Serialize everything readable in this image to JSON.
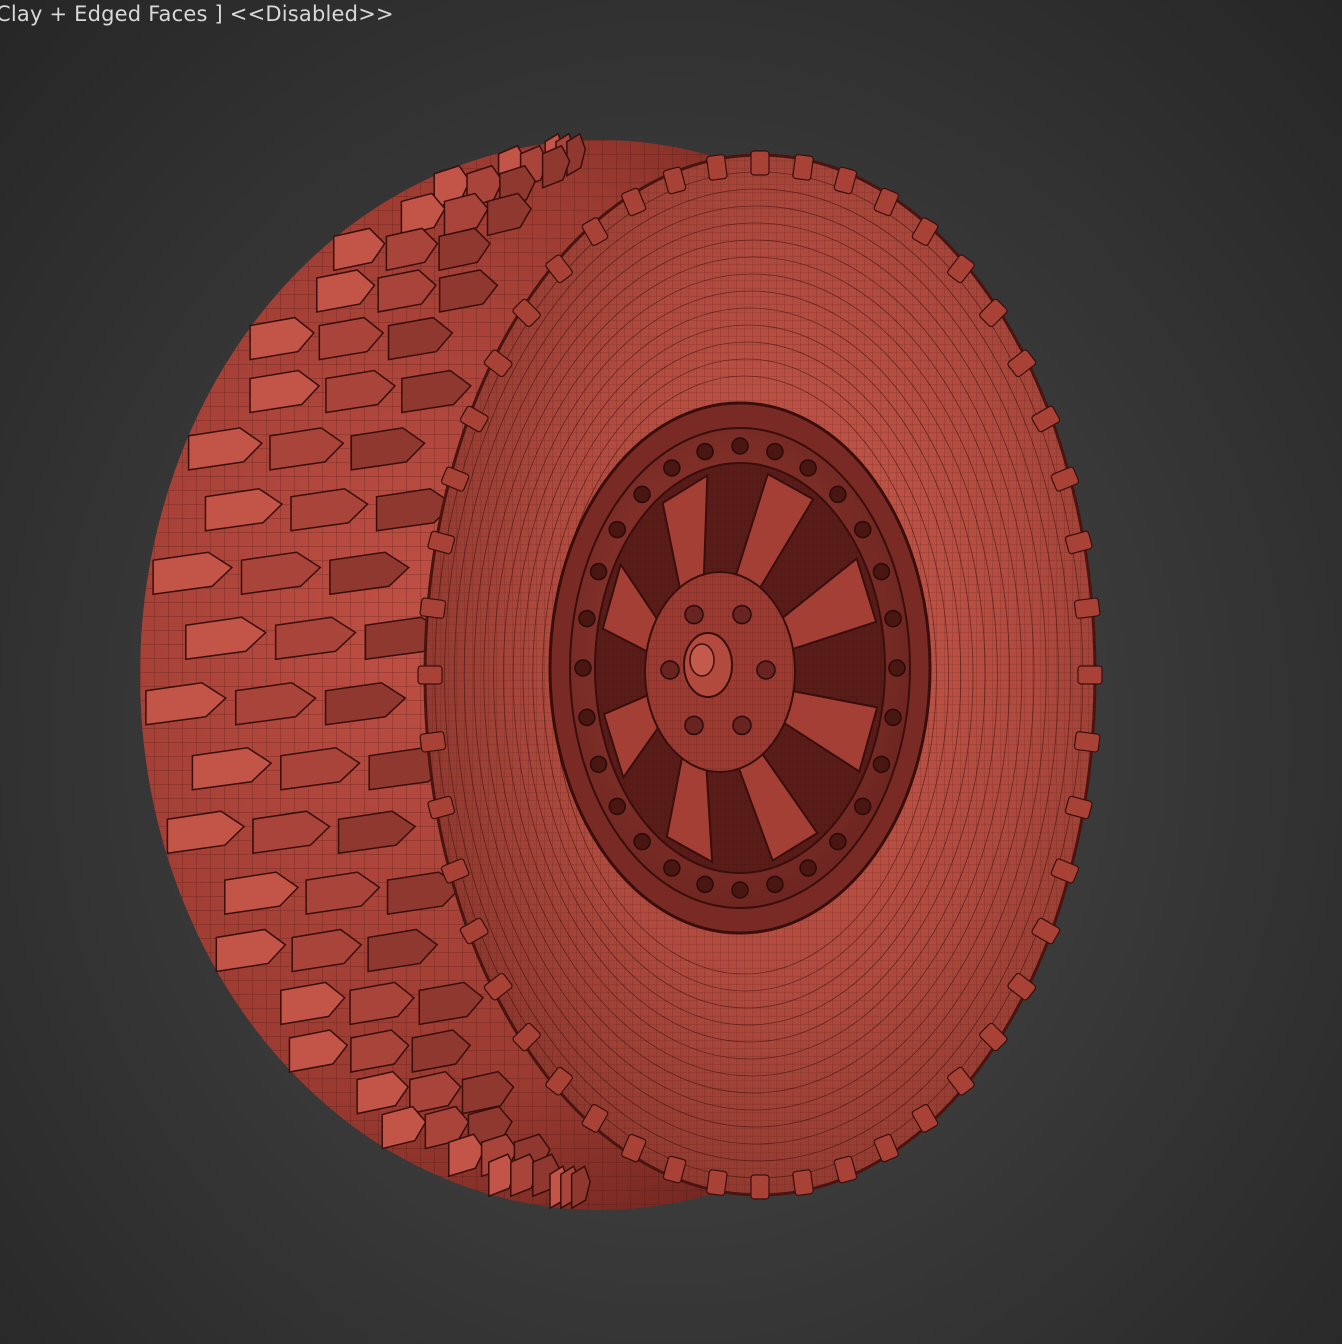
{
  "viewport": {
    "shading_mode_label": "Clay + Edged Faces ]",
    "status_label": "<<Disabled>>",
    "model_icon": "tire-wheel-wireframe-model"
  },
  "colors": {
    "background": "#3a3a3a",
    "clay": "#b0453a",
    "clay_dark": "#6e2420",
    "wire": "#3a0e0c",
    "label_text": "#d8d8d8"
  }
}
